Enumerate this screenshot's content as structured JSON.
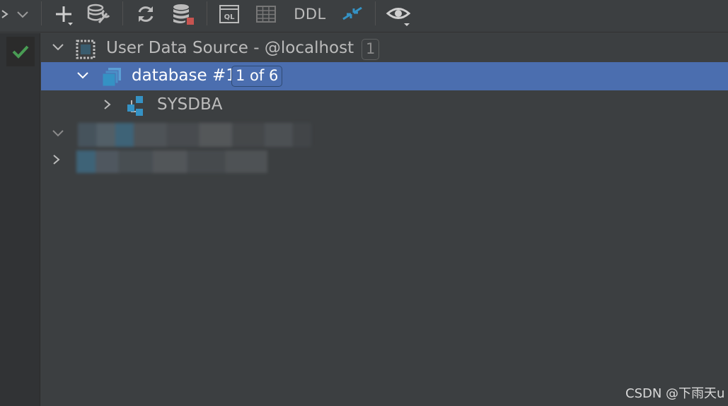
{
  "toolbar": {
    "ddl_label": "DDL"
  },
  "tree": {
    "data_source": {
      "label": "User Data Source - @localhost",
      "badge": "1"
    },
    "database": {
      "label": "database #1",
      "badge": "1 of 6"
    },
    "schema": {
      "label": "SYSDBA"
    }
  },
  "watermark": "CSDN @下雨天u",
  "colors": {
    "background": "#3c3f41",
    "selection": "#4b6eaf",
    "accent_blue": "#3592c4",
    "status_green": "#499c54",
    "stop_red": "#c75450"
  }
}
